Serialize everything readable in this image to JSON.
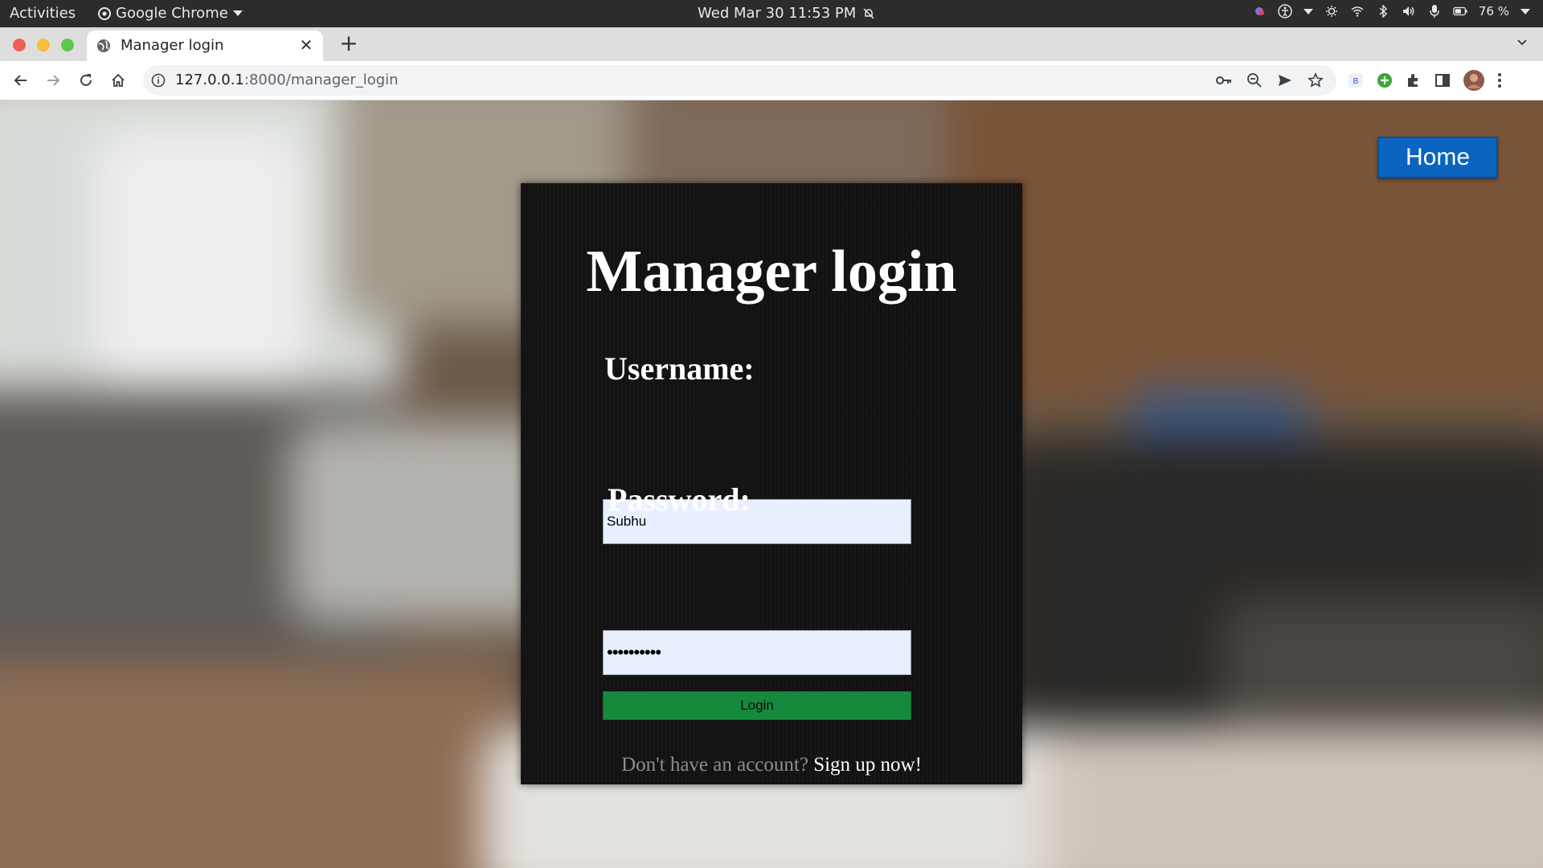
{
  "os_bar": {
    "activities": "Activities",
    "app_name": "Google Chrome",
    "datetime": "Wed Mar 30  11:53 PM",
    "battery": "76 %"
  },
  "browser": {
    "tab_title": "Manager login",
    "url_host": "127.0.0.1",
    "url_path": ":8000/manager_login"
  },
  "page": {
    "home_button": "Home",
    "title": "Manager login",
    "username_label": "Username:",
    "username_value": "Subhu",
    "password_label": "Password:",
    "password_value": "••••••••••",
    "login_button": "Login",
    "signup_prompt": "Don't have an account?",
    "signup_link": "Sign up now!"
  },
  "colors": {
    "home_button": "#0b64c0",
    "login_button": "#168a3c",
    "card": "#121212",
    "input_bg": "#e8f0fe"
  }
}
